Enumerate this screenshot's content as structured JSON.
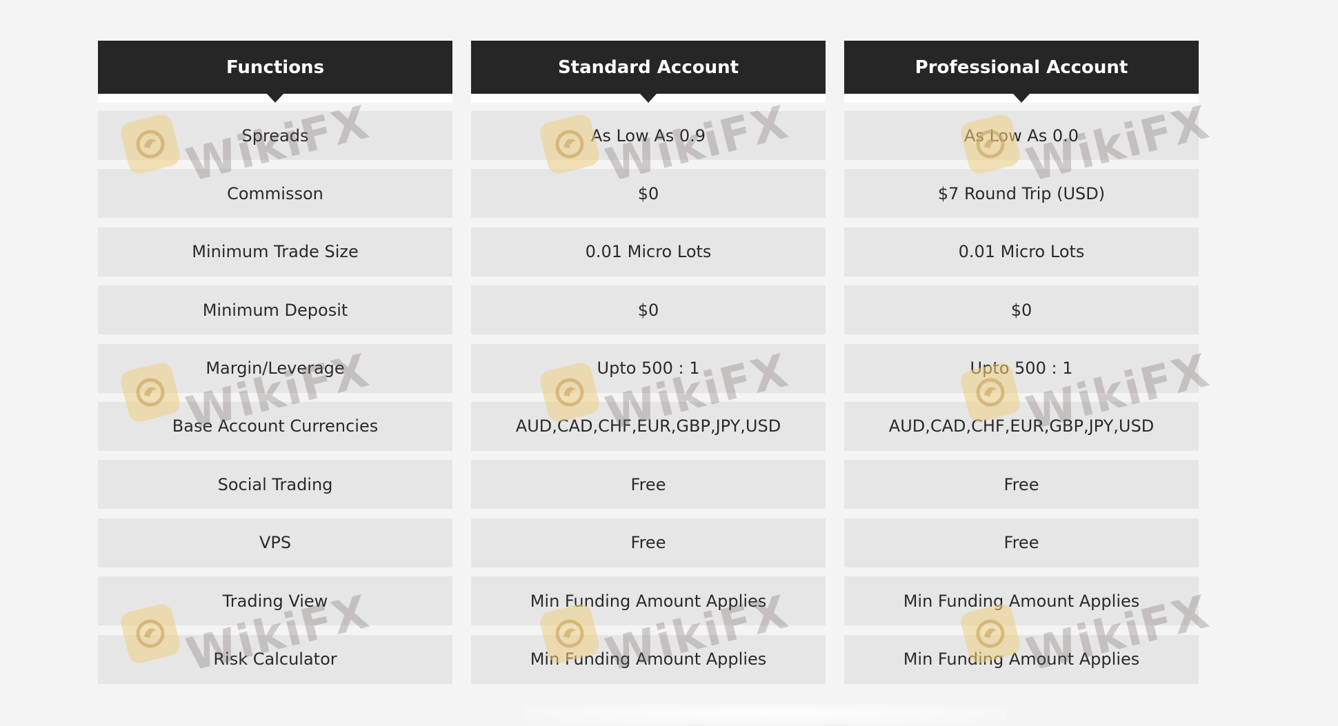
{
  "headers": [
    "Functions",
    "Standard Account",
    "Professional Account"
  ],
  "functions": [
    "Spreads",
    "Commisson",
    "Minimum Trade Size",
    "Minimum Deposit",
    "Margin/Leverage",
    "Base Account Currencies",
    "Social Trading",
    "VPS",
    "Trading View",
    "Risk Calculator"
  ],
  "standard": [
    "As Low As 0.9",
    "$0",
    "0.01 Micro Lots",
    "$0",
    "Upto 500 : 1",
    "AUD,CAD,CHF,EUR,GBP,JPY,USD",
    "Free",
    "Free",
    "Min Funding Amount Applies",
    "Min Funding Amount Applies"
  ],
  "professional": [
    "As Low As 0.0",
    "$7 Round Trip (USD)",
    "0.01 Micro Lots",
    "$0",
    "Upto 500 : 1",
    "AUD,CAD,CHF,EUR,GBP,JPY,USD",
    "Free",
    "Free",
    "Min Funding Amount Applies",
    "Min Funding Amount Applies"
  ],
  "watermark": {
    "text": "WikiFX",
    "icon": "wikifx-logo-icon"
  },
  "colors": {
    "header_bg": "#262626",
    "cell_bg": "#e6e6e6",
    "page_bg": "#f4f4f4"
  }
}
